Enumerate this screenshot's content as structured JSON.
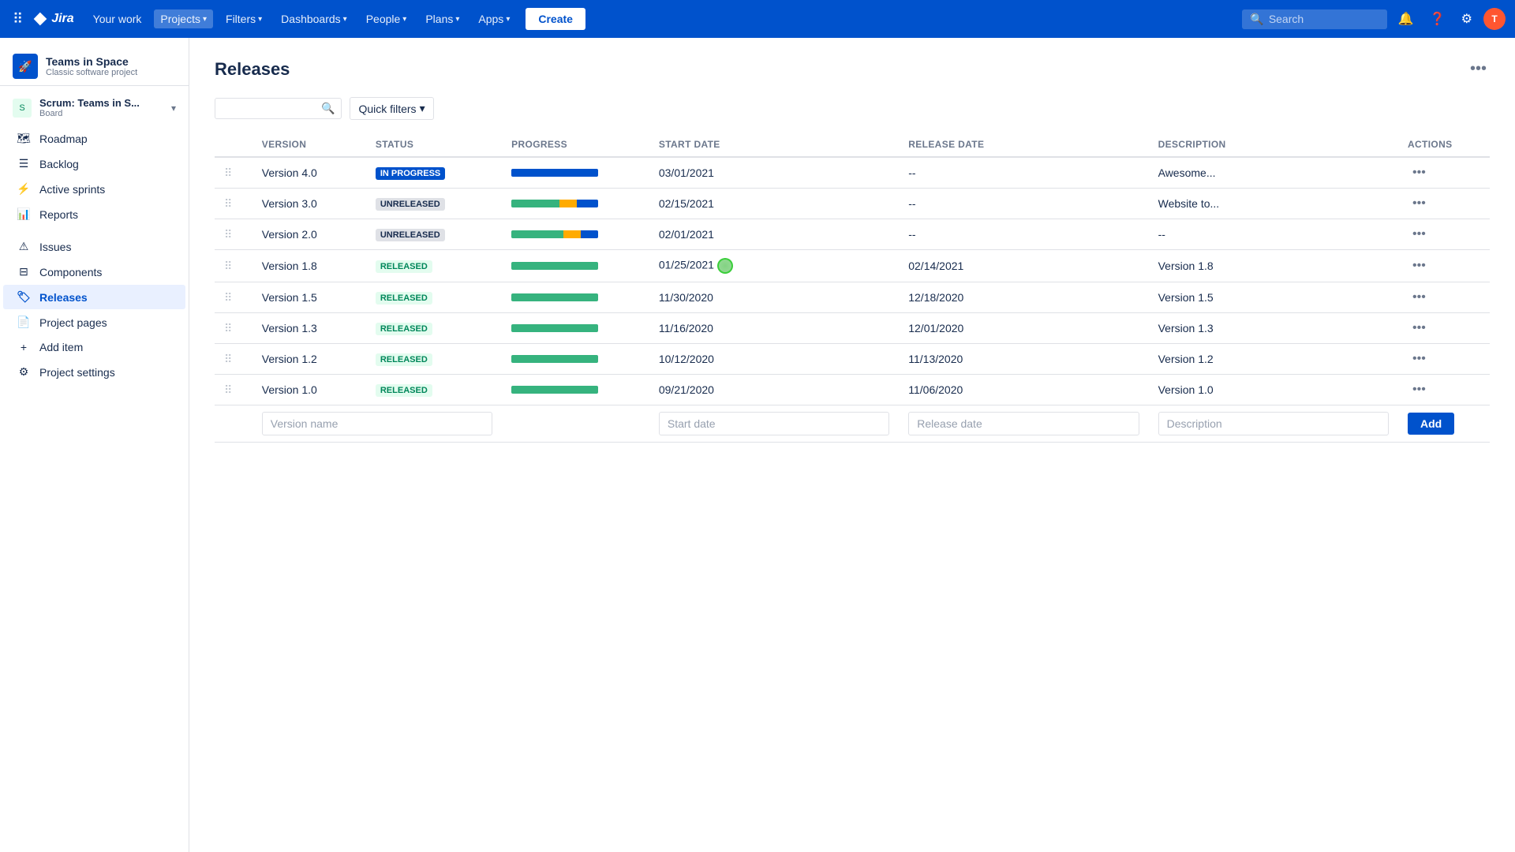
{
  "topnav": {
    "logo": "Jira",
    "links": [
      {
        "label": "Your work",
        "caret": false,
        "active": false
      },
      {
        "label": "Projects",
        "caret": true,
        "active": true
      },
      {
        "label": "Filters",
        "caret": true,
        "active": false
      },
      {
        "label": "Dashboards",
        "caret": true,
        "active": false
      },
      {
        "label": "People",
        "caret": true,
        "active": false
      },
      {
        "label": "Plans",
        "caret": true,
        "active": false
      },
      {
        "label": "Apps",
        "caret": true,
        "active": false
      }
    ],
    "create_label": "Create",
    "search_placeholder": "Search"
  },
  "sidebar": {
    "project": {
      "name": "Teams in Space",
      "type": "Classic software project"
    },
    "scrum": {
      "name": "Scrum: Teams in S...",
      "sub": "Board"
    },
    "items": [
      {
        "label": "Roadmap",
        "icon": "🗺"
      },
      {
        "label": "Backlog",
        "icon": "☰"
      },
      {
        "label": "Active sprints",
        "icon": "⚡"
      },
      {
        "label": "Reports",
        "icon": "📊"
      },
      {
        "label": "Issues",
        "icon": "⚠"
      },
      {
        "label": "Components",
        "icon": "⊟"
      },
      {
        "label": "Releases",
        "icon": "🏷",
        "active": true
      },
      {
        "label": "Project pages",
        "icon": "📄"
      },
      {
        "label": "Add item",
        "icon": "+"
      },
      {
        "label": "Project settings",
        "icon": "⚙"
      }
    ]
  },
  "page": {
    "title": "Releases",
    "quick_filters_label": "Quick filters"
  },
  "table": {
    "columns": [
      "",
      "Version",
      "Status",
      "Progress",
      "Start date",
      "Release date",
      "Description",
      "Actions"
    ],
    "rows": [
      {
        "version": "Version 4.0",
        "status": "IN PROGRESS",
        "status_class": "status-in-progress",
        "progress": [
          {
            "type": "blue",
            "pct": 100
          }
        ],
        "start_date": "03/01/2021",
        "release_date": "--",
        "description": "Awesome...",
        "has_cursor": false
      },
      {
        "version": "Version 3.0",
        "status": "UNRELEASED",
        "status_class": "status-unreleased",
        "progress": [
          {
            "type": "green",
            "pct": 55
          },
          {
            "type": "yellow",
            "pct": 20
          },
          {
            "type": "blue",
            "pct": 25
          }
        ],
        "start_date": "02/15/2021",
        "release_date": "--",
        "description": "Website to...",
        "has_cursor": false
      },
      {
        "version": "Version 2.0",
        "status": "UNRELEASED",
        "status_class": "status-unreleased",
        "progress": [
          {
            "type": "green",
            "pct": 60
          },
          {
            "type": "yellow",
            "pct": 20
          },
          {
            "type": "blue",
            "pct": 20
          }
        ],
        "start_date": "02/01/2021",
        "release_date": "--",
        "description": "--",
        "has_cursor": false
      },
      {
        "version": "Version 1.8",
        "status": "RELEASED",
        "status_class": "status-released",
        "progress": [
          {
            "type": "green",
            "pct": 100
          }
        ],
        "start_date": "01/25/2021",
        "release_date": "02/14/2021",
        "description": "Version 1.8",
        "has_cursor": true
      },
      {
        "version": "Version 1.5",
        "status": "RELEASED",
        "status_class": "status-released",
        "progress": [
          {
            "type": "green",
            "pct": 100
          }
        ],
        "start_date": "11/30/2020",
        "release_date": "12/18/2020",
        "description": "Version 1.5",
        "has_cursor": false
      },
      {
        "version": "Version 1.3",
        "status": "RELEASED",
        "status_class": "status-released",
        "progress": [
          {
            "type": "green",
            "pct": 100
          }
        ],
        "start_date": "11/16/2020",
        "release_date": "12/01/2020",
        "description": "Version 1.3",
        "has_cursor": false
      },
      {
        "version": "Version 1.2",
        "status": "RELEASED",
        "status_class": "status-released",
        "progress": [
          {
            "type": "green",
            "pct": 100
          }
        ],
        "start_date": "10/12/2020",
        "release_date": "11/13/2020",
        "description": "Version 1.2",
        "has_cursor": false
      },
      {
        "version": "Version 1.0",
        "status": "RELEASED",
        "status_class": "status-released",
        "progress": [
          {
            "type": "green",
            "pct": 100
          }
        ],
        "start_date": "09/21/2020",
        "release_date": "11/06/2020",
        "description": "Version 1.0",
        "has_cursor": false
      }
    ],
    "add_row": {
      "version_placeholder": "Version name",
      "start_date_placeholder": "Start date",
      "release_date_placeholder": "Release date",
      "description_placeholder": "Description",
      "add_label": "Add"
    }
  }
}
